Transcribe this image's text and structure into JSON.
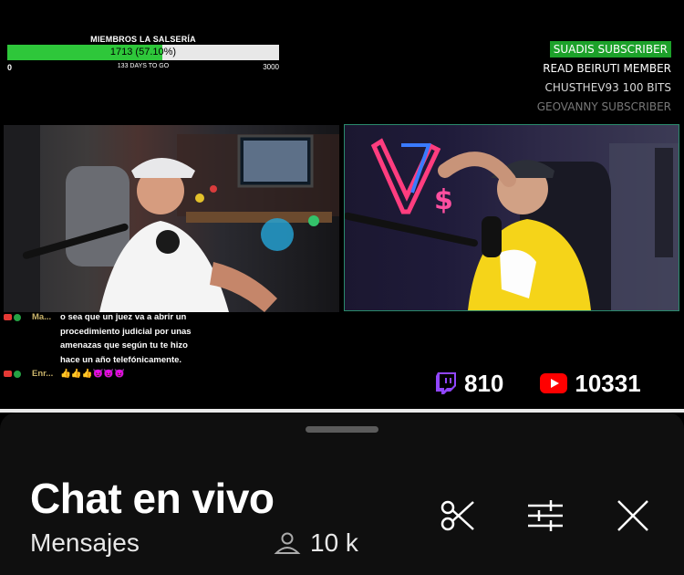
{
  "goal": {
    "title": "MIEMBROS LA SALSERÍA",
    "progress_text": "1713 (57.10%)",
    "progress_fraction": 0.571,
    "min": "0",
    "days": "133 DAYS TO GO",
    "max": "3000",
    "fill_color": "#2ec73a"
  },
  "alerts": [
    {
      "text": "SUADIS  SUBSCRIBER"
    },
    {
      "text": "READ BEIRUTI  MEMBER"
    },
    {
      "text": "CHUSTHEV93  100 BITS"
    },
    {
      "text": "GEOVANNY  SUBSCRIBER"
    }
  ],
  "chat": [
    {
      "user": "Ma...",
      "message": "o sea que un juez va a abrir un procedimiento judicial por unas amenazas que según tu te hizo hace un año telefónicamente."
    },
    {
      "user": "Enr...",
      "message": "👍👍👍😈😈😈"
    }
  ],
  "viewers": {
    "twitch": "810",
    "youtube": "10331",
    "twitch_color": "#9146ff",
    "youtube_color": "#ff0000"
  },
  "panel": {
    "title": "Chat en vivo",
    "subtitle": "Mensajes",
    "count": "10 k",
    "icons": [
      "scissors-icon",
      "sliders-icon",
      "close-icon"
    ]
  }
}
